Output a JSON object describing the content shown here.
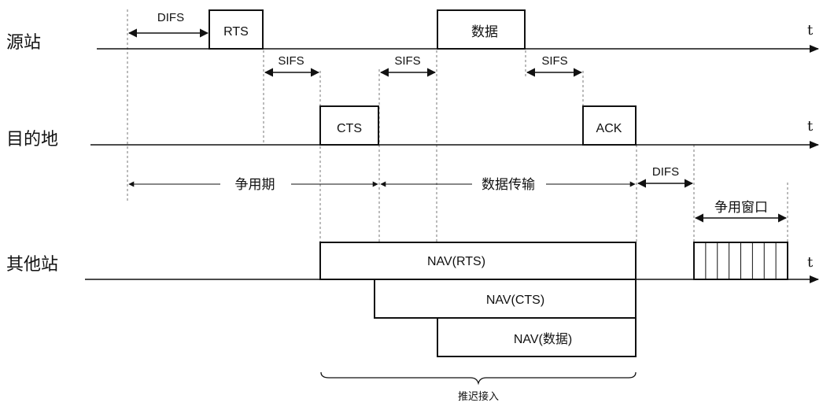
{
  "rows": {
    "source": "源站",
    "dest": "目的地",
    "others": "其他站"
  },
  "axis_label": "t",
  "frames": {
    "rts": "RTS",
    "data": "数据",
    "cts": "CTS",
    "ack": "ACK"
  },
  "intervals": {
    "difs": "DIFS",
    "sifs": "SIFS"
  },
  "phases": {
    "contention": "争用期",
    "transfer": "数据传输",
    "window": "争用窗口"
  },
  "nav": {
    "rts": "NAV(RTS)",
    "cts": "NAV(CTS)",
    "data": "NAV(数据)"
  },
  "deferred_access": "推迟接入",
  "contention_window_slots": 8
}
